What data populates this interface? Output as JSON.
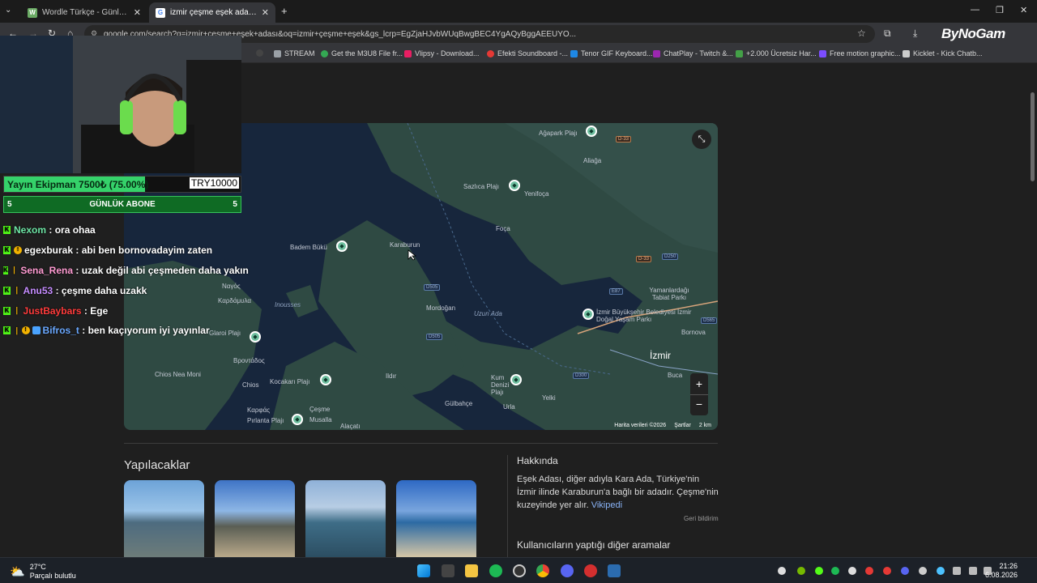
{
  "browser": {
    "tabs": [
      {
        "title": "Wordle Türkçe - Günlük Kelime",
        "favicon": "W",
        "color": "#6aaa64",
        "active": false
      },
      {
        "title": "izmir çeşme eşek adası - Google",
        "favicon": "G",
        "color": "#ffffff",
        "active": true
      }
    ],
    "new_tab": "+",
    "url": "google.com/search?q=izmir+çeşme+eşek+adası&oq=izmir+çeşme+eşek&gs_lcrp=EgZjaHJvbWUqBwgBEC4YgAQyBggAEEUYO...",
    "url_full": "google.com/search?q=izmir+çeşme+eşek+adası&oq=izmir+çeşme+eşek&gs_lcrp=EgZjaHJvbWUqBwgBEC4YgAQyBggAEEUYO...",
    "watermark": "ByNoGam",
    "bookmarks": [
      {
        "label": "STREAM",
        "color": "#9aa0a6"
      },
      {
        "label": "Get the M3U8 File fr...",
        "color": "#34a853"
      },
      {
        "label": "Vlipsy - Download...",
        "color": "#e91e63"
      },
      {
        "label": "Efekti Soundboard -...",
        "color": "#e53935"
      },
      {
        "label": "Tenor GIF Keyboard...",
        "color": "#1e88e5"
      },
      {
        "label": "ChatPlay - Twitch &...",
        "color": "#9c27b0"
      },
      {
        "label": "+2.000 Ücretsiz Har...",
        "color": "#43a047"
      },
      {
        "label": "Free motion graphic...",
        "color": "#7c4dff"
      },
      {
        "label": "Kicklet - Kick Chatb...",
        "color": "#cccccc"
      }
    ]
  },
  "map": {
    "labels": [
      {
        "text": "Ağapark Plajı",
        "kind": "normal"
      },
      {
        "text": "Aliağa",
        "kind": "normal"
      },
      {
        "text": "Sazlıca Plajı",
        "kind": "normal"
      },
      {
        "text": "Yenifoça",
        "kind": "normal"
      },
      {
        "text": "Foça",
        "kind": "normal"
      },
      {
        "text": "Badem Bükü",
        "kind": "normal"
      },
      {
        "text": "Karaburun",
        "kind": "normal"
      },
      {
        "text": "Yamanlardağı Tabiat Parkı",
        "kind": "normal"
      },
      {
        "text": "İzmir Büyükşehir Belediyesi İzmir Doğal Yaşam Parkı",
        "kind": "normal"
      },
      {
        "text": "Bornova",
        "kind": "normal"
      },
      {
        "text": "İzmir",
        "kind": "big"
      },
      {
        "text": "Buca",
        "kind": "normal"
      },
      {
        "text": "Mordoğan",
        "kind": "normal"
      },
      {
        "text": "Uzun Ada",
        "kind": "italic"
      },
      {
        "text": "Inousses",
        "kind": "italic"
      },
      {
        "text": "Ναγός",
        "kind": "normal"
      },
      {
        "text": "Καρδάμυλα",
        "kind": "normal"
      },
      {
        "text": "Glaroi Plajı",
        "kind": "normal"
      },
      {
        "text": "Βροντάδος",
        "kind": "normal"
      },
      {
        "text": "Chios Nea Moni",
        "kind": "normal"
      },
      {
        "text": "Chios",
        "kind": "normal"
      },
      {
        "text": "Kocakarı Plajı",
        "kind": "normal"
      },
      {
        "text": "Ildır",
        "kind": "normal"
      },
      {
        "text": "Kum Denizi Plajı",
        "kind": "normal"
      },
      {
        "text": "Yelki",
        "kind": "normal"
      },
      {
        "text": "Gülbahçe",
        "kind": "normal"
      },
      {
        "text": "Urla",
        "kind": "normal"
      },
      {
        "text": "Çeşme",
        "kind": "normal"
      },
      {
        "text": "Musalla",
        "kind": "normal"
      },
      {
        "text": "Alaçatı",
        "kind": "normal"
      },
      {
        "text": "Καρφάς",
        "kind": "normal"
      },
      {
        "text": "Pırlanta Plajı",
        "kind": "normal"
      }
    ],
    "roads": [
      "D-33",
      "D250",
      "D-33",
      "E87",
      "D565",
      "D505",
      "D505",
      "D300"
    ],
    "footer_data": "Harita verileri ©2026",
    "footer_terms": "Şartlar",
    "footer_scale": "2 km"
  },
  "page": {
    "section_title": "Yapılacaklar",
    "about_title": "Hakkında",
    "about_text": "Eşek Adası, diğer adıyla Kara Ada, Türkiye'nin İzmir ilinde Karaburun'a bağlı bir adadır. Çeşme'nin kuzeyinde yer alır.",
    "about_link": "Vikipedi",
    "feedback": "Geri bildirim",
    "others_title": "Kullanıcıların yaptığı diğer aramalar"
  },
  "overlay": {
    "donation_label": "Yayın Ekipman   7500₺ (75.00%)",
    "donation_goal": "TRY10000",
    "donation_progress": 0.75,
    "subs_left": "5",
    "subs_label": "GÜNLÜK ABONE",
    "subs_right": "5",
    "chat": [
      {
        "user": "Nexom",
        "text": "ora ohaa",
        "color": "#6ee7a6",
        "badge": ""
      },
      {
        "user": "egexburak",
        "text": "abi ben bornovadayim zaten",
        "color": "#ffffff",
        "badge": "!"
      },
      {
        "user": "Sena_Rena",
        "text": "uzak değil abi çeşmeden daha yakın",
        "color": "#ff9bd2",
        "badge": ""
      },
      {
        "user": "Anu53",
        "text": "çeşme daha uzakk",
        "color": "#c58cff",
        "badge": ""
      },
      {
        "user": "JustBaybars",
        "text": "Ege",
        "color": "#ff3b3b",
        "badge": ""
      },
      {
        "user": "Bifros_t",
        "text": "ben kaçıyorum iyi yayınlar",
        "color": "#6aa8ff",
        "badge": "!"
      }
    ]
  },
  "taskbar": {
    "temp": "27°C",
    "weather": "Parçalı bulutlu",
    "time": "21:26",
    "date": "6.08.2026"
  }
}
